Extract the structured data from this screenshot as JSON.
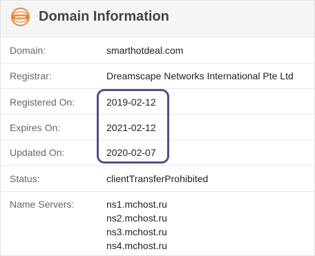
{
  "header": {
    "icon": "www-globe-icon",
    "icon_text": "www",
    "title": "Domain Information"
  },
  "rows": [
    {
      "label": "Domain:",
      "value": "smarthotdeal.com"
    },
    {
      "label": "Registrar:",
      "value": "Dreamscape Networks International Pte Ltd"
    },
    {
      "label": "Registered On:",
      "value": "2019-02-12"
    },
    {
      "label": "Expires On:",
      "value": "2021-02-12"
    },
    {
      "label": "Updated On:",
      "value": "2020-02-07"
    },
    {
      "label": "Status:",
      "value": "clientTransferProhibited"
    }
  ],
  "name_servers": {
    "label": "Name Servers:",
    "values": [
      "ns1.mchost.ru",
      "ns2.mchost.ru",
      "ns3.mchost.ru",
      "ns4.mchost.ru"
    ]
  },
  "colors": {
    "icon_accent": "#e8893a",
    "highlight_border": "#5b4a86",
    "header_bg": "#f5f5f5"
  }
}
